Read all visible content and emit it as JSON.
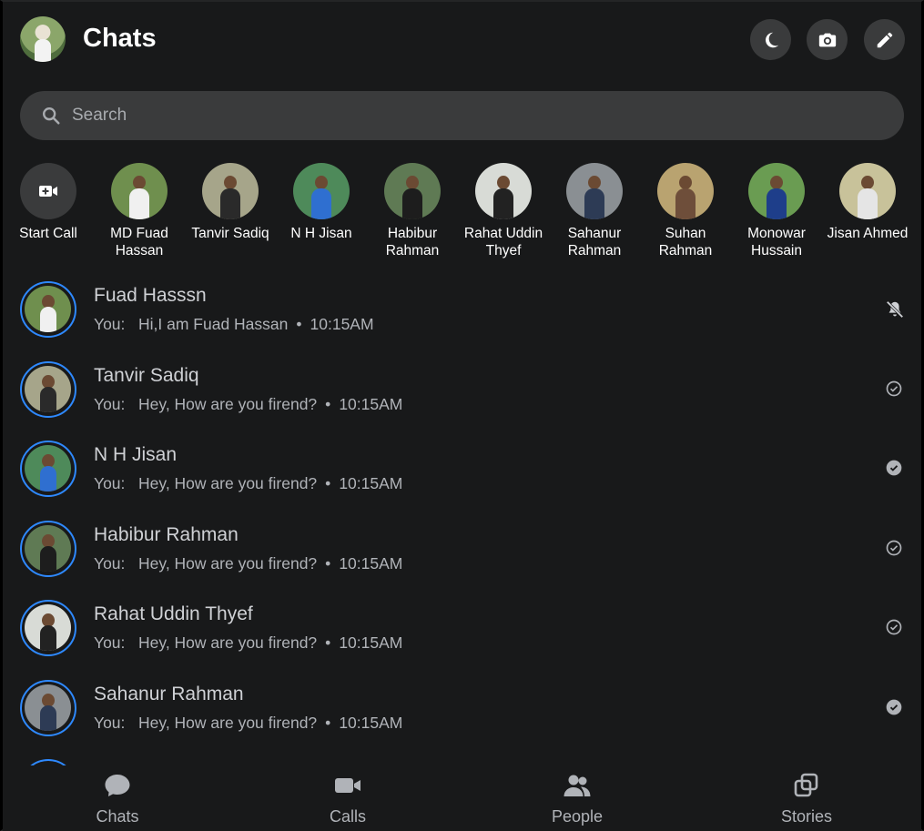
{
  "header": {
    "title": "Chats",
    "buttons": [
      {
        "name": "dark-mode-button",
        "icon": "moon-icon"
      },
      {
        "name": "camera-button",
        "icon": "camera-icon"
      },
      {
        "name": "compose-button",
        "icon": "pencil-icon"
      }
    ]
  },
  "search": {
    "placeholder": "Search",
    "value": ""
  },
  "stories": [
    {
      "label": "Start Call",
      "type": "action",
      "icon": "video-plus-icon"
    },
    {
      "label": "MD Fuad Hassan",
      "bg": "#6f8f4e",
      "shirt": "#f0f0f0"
    },
    {
      "label": "Tanvir Sadiq",
      "bg": "#a6a58a",
      "shirt": "#2a2a2a"
    },
    {
      "label": "N H Jisan",
      "bg": "#4e8a5a",
      "shirt": "#2f6fd0"
    },
    {
      "label": "Habibur Rahman",
      "bg": "#5f7a54",
      "shirt": "#1d1d1d"
    },
    {
      "label": "Rahat Uddin Thyef",
      "bg": "#d8dbd6",
      "shirt": "#222222"
    },
    {
      "label": "Sahanur Rahman",
      "bg": "#8a8f93",
      "shirt": "#2d3b55"
    },
    {
      "label": "Suhan Rahman",
      "bg": "#b9a370",
      "shirt": "#6e4e3a"
    },
    {
      "label": "Monowar Hussain",
      "bg": "#6a9c52",
      "shirt": "#1e3e8a"
    },
    {
      "label": "Jisan Ahmed",
      "bg": "#c8c29a",
      "shirt": "#e5e5e5"
    }
  ],
  "chats": [
    {
      "name": "Fuad Hasssn",
      "you": "You:",
      "message": "Hi,I am Fuad Hassan",
      "time": "10:15AM",
      "status": "muted",
      "bg": "#6f8f4e",
      "shirt": "#f0f0f0"
    },
    {
      "name": "Tanvir Sadiq",
      "you": "You:",
      "message": "Hey, How are you firend?",
      "time": "10:15AM",
      "status": "sent",
      "bg": "#a6a58a",
      "shirt": "#2a2a2a"
    },
    {
      "name": "N H Jisan",
      "you": "You:",
      "message": "Hey, How are you firend?",
      "time": "10:15AM",
      "status": "delivered",
      "bg": "#4e8a5a",
      "shirt": "#2f6fd0"
    },
    {
      "name": "Habibur Rahman",
      "you": "You:",
      "message": "Hey, How are you firend?",
      "time": "10:15AM",
      "status": "sent",
      "bg": "#5f7a54",
      "shirt": "#1d1d1d"
    },
    {
      "name": "Rahat Uddin Thyef",
      "you": "You:",
      "message": "Hey, How are you firend?",
      "time": "10:15AM",
      "status": "sent",
      "bg": "#d8dbd6",
      "shirt": "#222222"
    },
    {
      "name": "Sahanur Rahman",
      "you": "You:",
      "message": "Hey, How are you firend?",
      "time": "10:15AM",
      "status": "delivered",
      "bg": "#8a8f93",
      "shirt": "#2d3b55"
    }
  ],
  "bottom_nav": [
    {
      "label": "Chats",
      "icon": "chat-bubble-icon"
    },
    {
      "label": "Calls",
      "icon": "video-camera-icon"
    },
    {
      "label": "People",
      "icon": "people-icon"
    },
    {
      "label": "Stories",
      "icon": "stories-icon"
    }
  ],
  "colors": {
    "accent": "#2e89ff",
    "background": "#18191a",
    "surface": "#3a3b3c"
  }
}
